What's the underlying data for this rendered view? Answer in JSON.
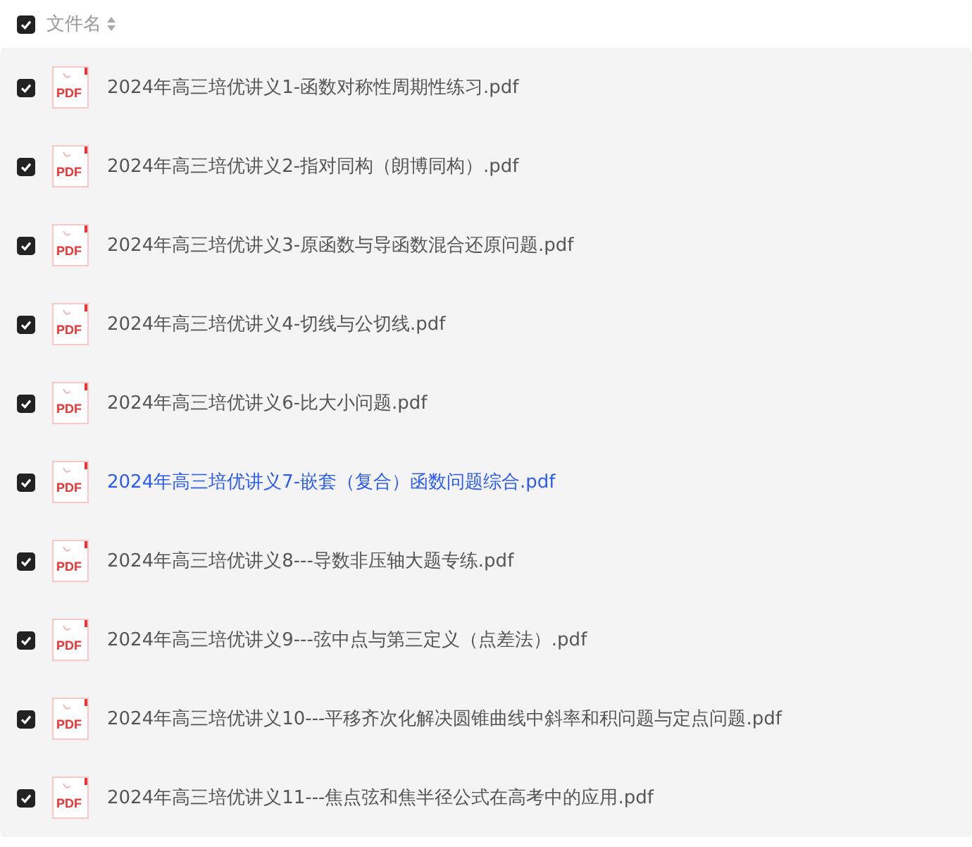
{
  "header": {
    "checked": true,
    "column": "文件名"
  },
  "rows": [
    {
      "name": "2024年高三培优讲义1-函数对称性周期性练习.pdf",
      "icon_text": "PDF",
      "checked": true,
      "highlighted": false
    },
    {
      "name": "2024年高三培优讲义2-指对同构（朗博同构）.pdf",
      "icon_text": "PDF",
      "checked": true,
      "highlighted": false
    },
    {
      "name": "2024年高三培优讲义3-原函数与导函数混合还原问题.pdf",
      "icon_text": "PDF",
      "checked": true,
      "highlighted": false
    },
    {
      "name": "2024年高三培优讲义4-切线与公切线.pdf",
      "icon_text": "PDF",
      "checked": true,
      "highlighted": false
    },
    {
      "name": "2024年高三培优讲义6-比大小问题.pdf",
      "icon_text": "PDF",
      "checked": true,
      "highlighted": false
    },
    {
      "name": "2024年高三培优讲义7-嵌套（复合）函数问题综合.pdf",
      "icon_text": "PDF",
      "checked": true,
      "highlighted": true
    },
    {
      "name": "2024年高三培优讲义8---导数非压轴大题专练.pdf",
      "icon_text": "PDF",
      "checked": true,
      "highlighted": false
    },
    {
      "name": "2024年高三培优讲义9---弦中点与第三定义（点差法）.pdf",
      "icon_text": "PDF",
      "checked": true,
      "highlighted": false
    },
    {
      "name": "2024年高三培优讲义10---平移齐次化解决圆锥曲线中斜率和积问题与定点问题.pdf",
      "icon_text": "PDF",
      "checked": true,
      "highlighted": false
    },
    {
      "name": "2024年高三培优讲义11---焦点弦和焦半径公式在高考中的应用.pdf",
      "icon_text": "PDF",
      "checked": true,
      "highlighted": false
    }
  ]
}
